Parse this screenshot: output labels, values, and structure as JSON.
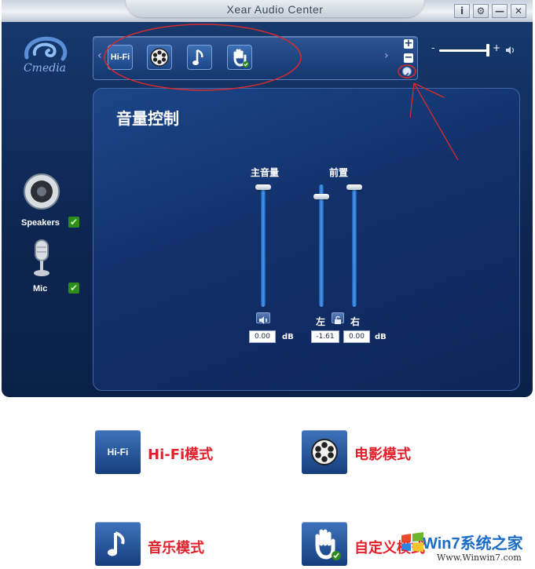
{
  "window": {
    "title": "Xear Audio Center",
    "controls": [
      "i",
      "⚙",
      "—",
      "✕"
    ]
  },
  "logo": {
    "text": "Cmedia"
  },
  "mode_bar": {
    "hifi_label": "Hi-Fi",
    "modes": [
      "hifi-icon",
      "movie-reel-icon",
      "music-note-icon",
      "hand-custom-icon"
    ],
    "plus": "+",
    "minus": "−"
  },
  "devices": [
    {
      "label": "Speakers",
      "icon": "speaker-icon",
      "checked": true
    },
    {
      "label": "Mic",
      "icon": "microphone-icon",
      "checked": true
    }
  ],
  "panel": {
    "title": "音量控制",
    "master": {
      "label": "主音量",
      "value": "0.00",
      "unit": "dB",
      "level": 1.0
    },
    "front": {
      "label": "前置",
      "left_label": "左",
      "right_label": "右",
      "left_value": "-1.61",
      "right_value": "0.00",
      "unit": "dB",
      "left_level": 0.92,
      "right_level": 1.0
    }
  },
  "legend": [
    {
      "icon": "hifi-icon",
      "icon_text": "Hi-Fi",
      "text": "Hi-Fi模式"
    },
    {
      "icon": "movie-reel-icon",
      "text": "电影模式"
    },
    {
      "icon": "music-note-icon",
      "text": "音乐模式"
    },
    {
      "icon": "hand-custom-icon",
      "text": "自定义模式"
    }
  ],
  "watermark": {
    "main": "Win7系统之家",
    "url": "Www.Winwin7.com"
  },
  "colors": {
    "annotation": "#d62b2b",
    "legend_text": "#e2202b",
    "check": "#2e8c1e"
  }
}
